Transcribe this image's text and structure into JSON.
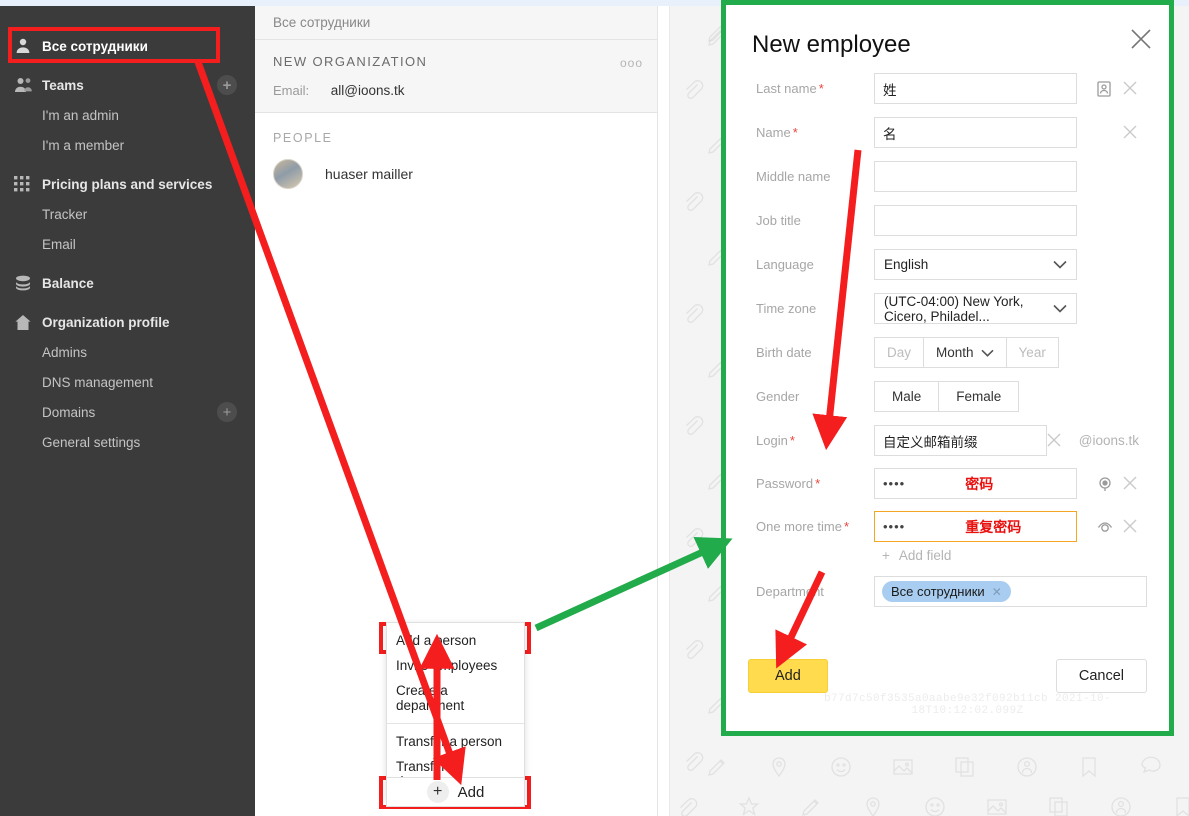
{
  "sidebar": {
    "items": [
      {
        "label": "Все сотрудники",
        "icon": "person-icon",
        "level": "head",
        "active": true,
        "plus": false
      },
      {
        "label": "Teams",
        "icon": "people-icon",
        "level": "head",
        "active": false,
        "plus": true
      },
      {
        "label": "I'm an admin",
        "icon": "",
        "level": "sub",
        "active": false,
        "plus": false
      },
      {
        "label": "I'm a member",
        "icon": "",
        "level": "sub",
        "active": false,
        "plus": false
      },
      {
        "label": "Pricing plans and services",
        "icon": "grid-icon",
        "level": "head",
        "active": false,
        "plus": false
      },
      {
        "label": "Tracker",
        "icon": "",
        "level": "sub",
        "active": false,
        "plus": false
      },
      {
        "label": "Email",
        "icon": "",
        "level": "sub",
        "active": false,
        "plus": false
      },
      {
        "label": "Balance",
        "icon": "database-icon",
        "level": "head",
        "active": false,
        "plus": false
      },
      {
        "label": "Organization profile",
        "icon": "home-icon",
        "level": "head",
        "active": false,
        "plus": false
      },
      {
        "label": "Admins",
        "icon": "",
        "level": "sub",
        "active": false,
        "plus": false
      },
      {
        "label": "DNS management",
        "icon": "",
        "level": "sub",
        "active": false,
        "plus": false
      },
      {
        "label": "Domains",
        "icon": "",
        "level": "sub",
        "active": false,
        "plus": true
      },
      {
        "label": "General settings",
        "icon": "",
        "level": "sub",
        "active": false,
        "plus": false
      }
    ]
  },
  "content": {
    "breadcrumb": "Все сотрудники",
    "org_name": "NEW ORGANIZATION",
    "email_label": "Email:",
    "email_value": "all@ioons.tk",
    "more_dots": "ooo",
    "people_header": "PEOPLE",
    "people": [
      {
        "name": "huaser mailler"
      }
    ]
  },
  "context_menu": {
    "items": [
      {
        "label": "Add a person",
        "highlighted": true
      },
      {
        "label": "Invite employees",
        "highlighted": false
      },
      {
        "label": "Create a department",
        "highlighted": false
      },
      {
        "label": "Transfer a person",
        "highlighted": false
      },
      {
        "label": "Transfer departments",
        "highlighted": false
      }
    ],
    "separator_after_index": 2
  },
  "add_bar": {
    "plus": "+",
    "label": "Add"
  },
  "modal": {
    "title": "New employee",
    "close_icon": "close-icon",
    "fields": {
      "last_name": {
        "label": "Last name",
        "required": true,
        "value": "姓",
        "placeholder": ""
      },
      "first_name": {
        "label": "Name",
        "required": true,
        "value": "名",
        "placeholder": ""
      },
      "middle_name": {
        "label": "Middle name",
        "required": false,
        "value": "",
        "placeholder": ""
      },
      "job_title": {
        "label": "Job title",
        "required": false,
        "value": "",
        "placeholder": ""
      },
      "language": {
        "label": "Language",
        "required": false,
        "value": "English"
      },
      "time_zone": {
        "label": "Time zone",
        "required": false,
        "value": "(UTC-04:00) New York, Cicero, Philadel..."
      },
      "birth_date": {
        "label": "Birth date",
        "day_placeholder": "Day",
        "month_value": "Month",
        "year_placeholder": "Year"
      },
      "gender": {
        "label": "Gender",
        "male": "Male",
        "female": "Female"
      },
      "login": {
        "label": "Login",
        "required": true,
        "value": "自定义邮箱前缀",
        "suffix": "@ioons.tk"
      },
      "password": {
        "label": "Password",
        "required": true,
        "value": "••••",
        "note": "密码"
      },
      "password_repeat": {
        "label": "One more time",
        "required": true,
        "value": "••••",
        "note": "重复密码"
      },
      "add_field": {
        "label": "Add field",
        "plus": "+"
      },
      "department": {
        "label": "Department",
        "chip": "Все сотрудники"
      }
    },
    "buttons": {
      "add": "Add",
      "cancel": "Cancel"
    },
    "watermark": "b77d7c50f3535a0aabe9e32f092b11cb 2021-10-18T10:12:02.099Z"
  },
  "colors": {
    "green_highlight": "#22ab4b",
    "red_highlight": "#f51e1e",
    "accent_yellow": "#ffdb4d",
    "chip_blue": "#a8cdf0",
    "sidebar_bg": "#3b3b3b"
  }
}
